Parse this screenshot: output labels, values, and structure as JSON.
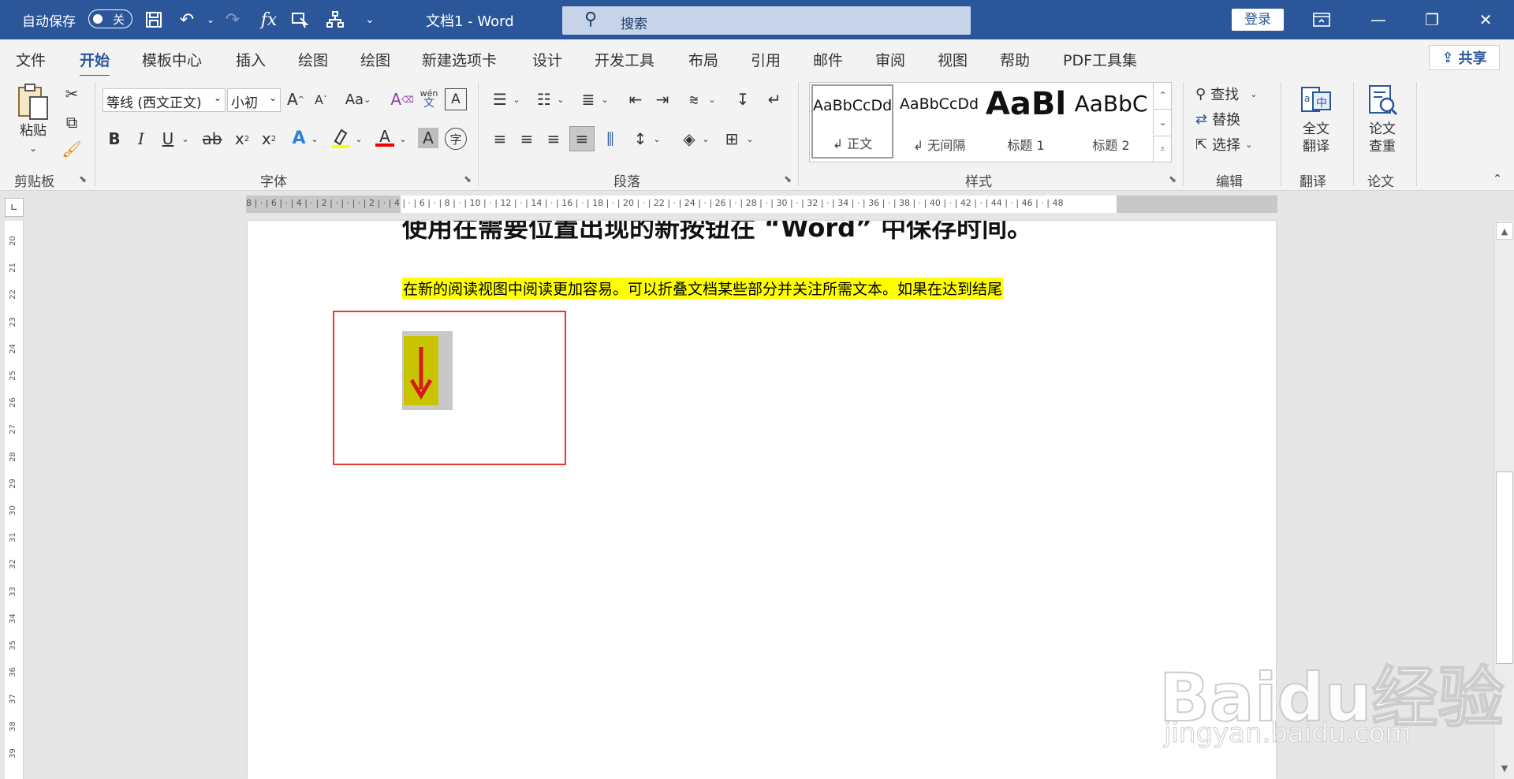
{
  "titlebar": {
    "autosave_label": "自动保存",
    "autosave_state": "关",
    "doc_title": "文档1  -  Word",
    "search_placeholder": "搜索",
    "login_label": "登录"
  },
  "tabs": [
    "文件",
    "开始",
    "模板中心",
    "插入",
    "绘图",
    "绘图",
    "新建选项卡",
    "设计",
    "开发工具",
    "布局",
    "引用",
    "邮件",
    "审阅",
    "视图",
    "帮助",
    "PDF工具集"
  ],
  "active_tab": "开始",
  "share_label": "共享",
  "ribbon": {
    "clipboard": {
      "paste": "粘贴",
      "group": "剪贴板"
    },
    "font": {
      "name": "等线 (西文正文)",
      "size": "小初",
      "group": "字体",
      "case_btn": "Aa",
      "phonetic_top": "wén",
      "phonetic_bottom": "文"
    },
    "paragraph": {
      "group": "段落"
    },
    "styles": {
      "group": "样式",
      "items": [
        {
          "sample": "AaBbCcDd",
          "name": "正文"
        },
        {
          "sample": "AaBbCcDd",
          "name": "无间隔"
        },
        {
          "sample": "AaBl",
          "name": "标题 1"
        },
        {
          "sample": "AaBbC",
          "name": "标题 2"
        }
      ]
    },
    "editing": {
      "find": "查找",
      "replace": "替换",
      "select": "选择",
      "group": "编辑"
    },
    "translate": {
      "full_text": "全文",
      "translate": "翻译",
      "group": "翻译"
    },
    "paper": {
      "check": "论文",
      "recheck": "查重",
      "group": "论文"
    }
  },
  "ruler": {
    "h_numbers": "8 | · | 6 | · | 4 | · | 2 | · | · | · | 2 | · | 4 | · | 6 | · | 8 | · | 10 | · | 12 | · | 14 | · | 16 | · | 18 | · | 20 | · | 22 | · | 24 | · | 26 | · | 28 | · | 30 | · | 32 | · | 34 | · | 36 | · | 38 | · | 40 | · | 42 | · | 44 | · | 46 | · | 48",
    "v_numbers": [
      "20",
      "21",
      "22",
      "23",
      "24",
      "25",
      "26",
      "27",
      "28",
      "29",
      "30",
      "31",
      "32",
      "33",
      "34",
      "35",
      "36",
      "37",
      "38",
      "39"
    ]
  },
  "document": {
    "heading": "使用在需要位置出现的新按钮在 “Word” 中保存时间。",
    "paragraph": "在新的阅读视图中阅读更加容易。可以折叠文档某些部分并关注所需文本。如果在达到结尾"
  },
  "watermark": {
    "logo": "Baidu经验",
    "url": "jingyan.baidu.com"
  },
  "colors": {
    "word_blue": "#2b579a",
    "highlight": "#ffff00",
    "red_box": "#e53935"
  }
}
